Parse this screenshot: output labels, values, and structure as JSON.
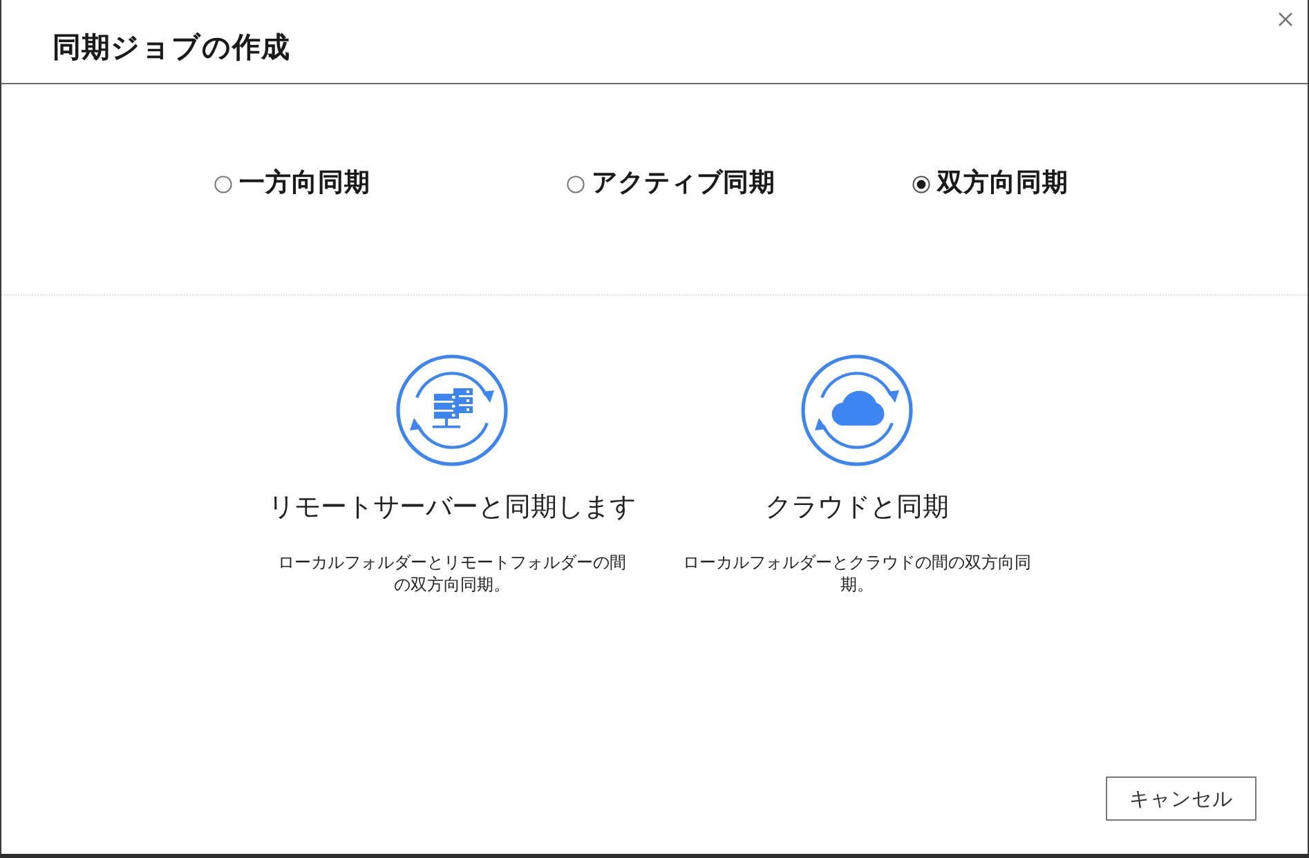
{
  "dialog": {
    "title": "同期ジョブの作成"
  },
  "sync_modes": [
    {
      "label": "一方向同期",
      "selected": false
    },
    {
      "label": "アクティブ同期",
      "selected": false
    },
    {
      "label": "双方向同期",
      "selected": true
    }
  ],
  "targets": [
    {
      "kind": "server",
      "title": "リモートサーバーと同期します",
      "description": "ローカルフォルダーとリモートフォルダーの間の双方向同期。"
    },
    {
      "kind": "cloud",
      "title": "クラウドと同期",
      "description": "ローカルフォルダーとクラウドの間の双方向同期。"
    }
  ],
  "footer": {
    "cancel_button": "キャンセル"
  }
}
